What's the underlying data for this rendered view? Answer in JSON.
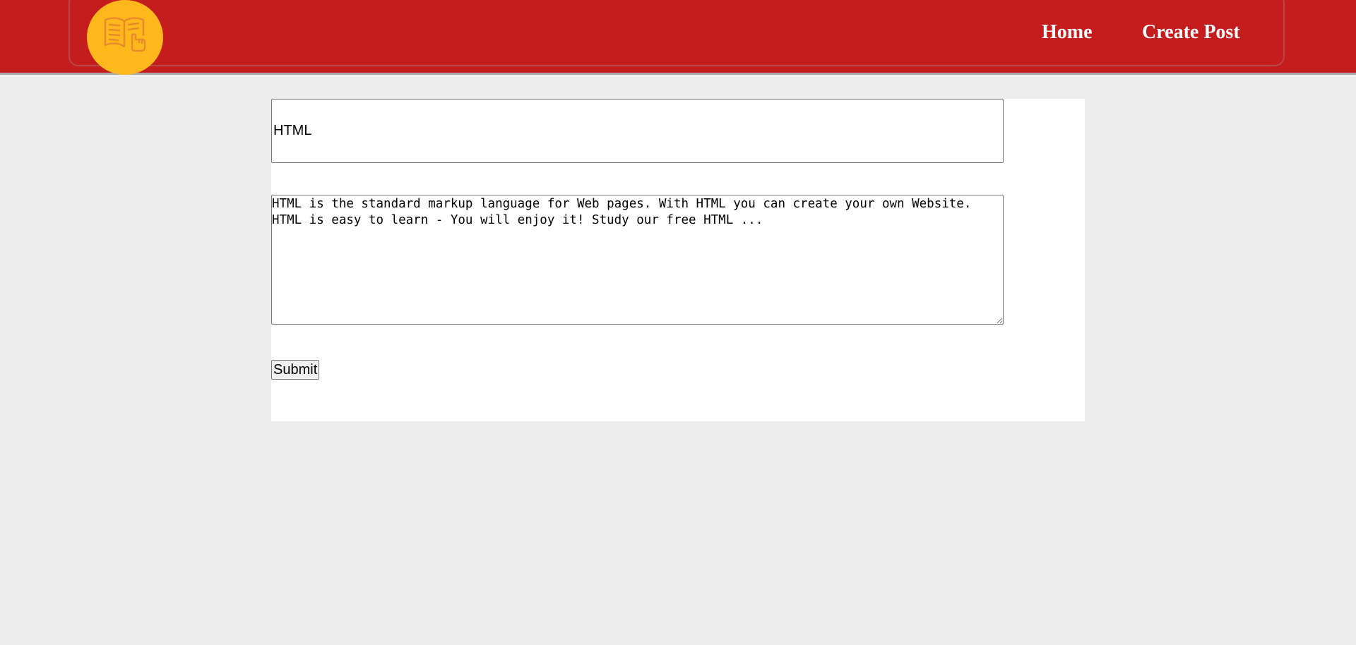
{
  "header": {
    "logo_icon": "book-reading-icon",
    "nav": {
      "home_label": "Home",
      "create_post_label": "Create Post"
    }
  },
  "form": {
    "title_value": "HTML",
    "body_value": "HTML is the standard markup language for Web pages. With HTML you can create your own Website. HTML is easy to learn - You will enjoy it! Study our free HTML ...",
    "submit_label": "Submit"
  },
  "colors": {
    "header_bg": "#c51d1d",
    "logo_bg": "#ffb81c",
    "page_bg": "#ededed"
  }
}
